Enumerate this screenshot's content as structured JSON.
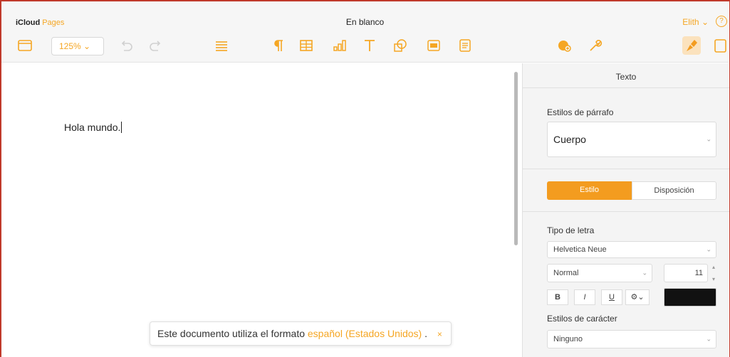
{
  "app": {
    "brand": "iCloud",
    "product": "Pages",
    "document_title": "En blanco",
    "user_menu": "Elith",
    "accent_color": "#f5a623"
  },
  "toolbar": {
    "zoom": "125% ⌄",
    "icons": [
      "view-icon",
      "undo-icon",
      "redo-icon",
      "list-icon",
      "paragraph-icon",
      "table-icon",
      "chart-icon",
      "text-icon",
      "shape-icon",
      "media-icon",
      "comment-icon",
      "collaborate-icon",
      "wrench-icon",
      "format-brush-icon",
      "document-icon"
    ]
  },
  "document": {
    "text": "Hola mundo."
  },
  "notice": {
    "prefix": "Este documento utiliza el formato",
    "link": "español (Estados Unidos)",
    "suffix": ".",
    "close": "×"
  },
  "inspector": {
    "title": "Texto",
    "paragraph_styles_label": "Estilos de párrafo",
    "paragraph_style": "Cuerpo",
    "tabs": [
      "Estilo",
      "Disposición"
    ],
    "font_label": "Tipo de letra",
    "font_family": "Helvetica Neue",
    "font_weight": "Normal",
    "font_size": "11",
    "format_buttons": [
      "B",
      "I",
      "U",
      "⚙⌄"
    ],
    "text_color": "#111111",
    "char_styles_label": "Estilos de carácter",
    "char_style": "Ninguno"
  }
}
